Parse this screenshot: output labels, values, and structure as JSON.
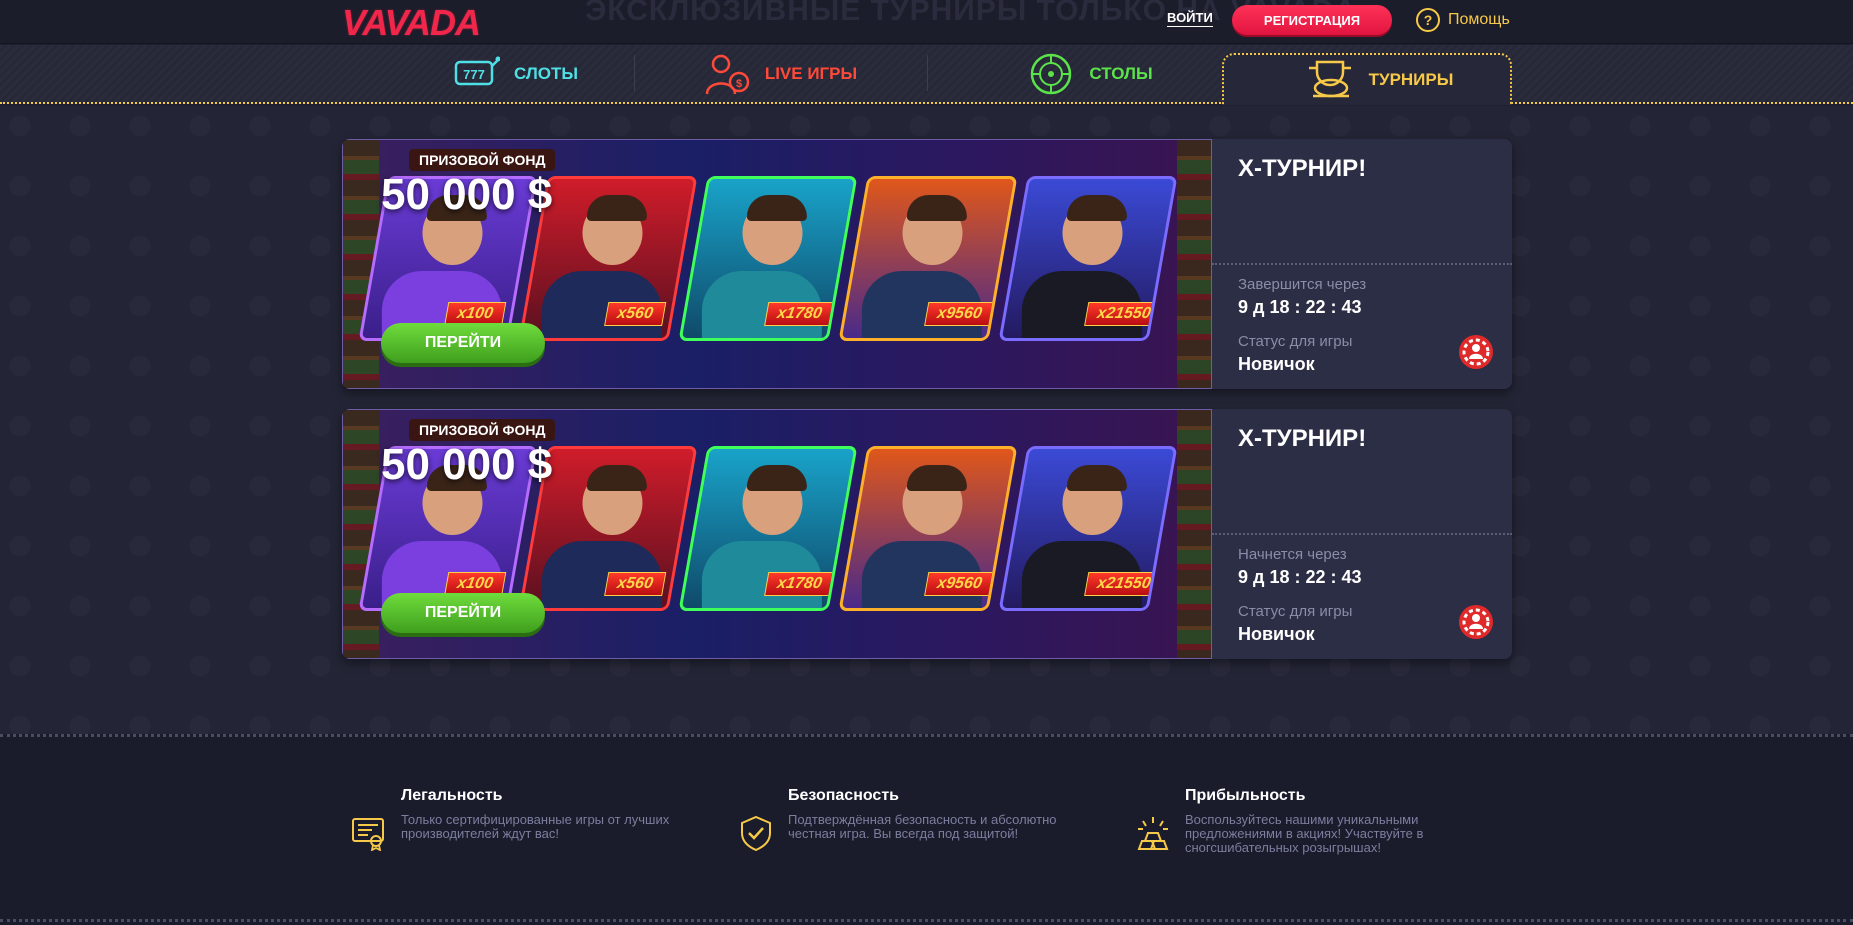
{
  "header": {
    "logo": "VAVADA",
    "ghost_title": "ЭКСКЛЮЗИВНЫЕ ТУРНИРЫ ТОЛЬКО НА VAVADA",
    "login": "ВОЙТИ",
    "register": "РЕГИСТРАЦИЯ",
    "help": "Помощь"
  },
  "nav": {
    "tabs": [
      {
        "label": "СЛОТЫ",
        "color": "#4fe0e6",
        "icon": "slots-777-icon"
      },
      {
        "label": "LIVE ИГРЫ",
        "color": "#ff4a3a",
        "icon": "live-dealer-icon"
      },
      {
        "label": "СТОЛЫ",
        "color": "#5be34a",
        "icon": "roulette-table-icon"
      },
      {
        "label": "ТУРНИРЫ",
        "color": "#f7c948",
        "icon": "piggy-trophy-icon",
        "active": true
      }
    ]
  },
  "tournaments": [
    {
      "prize_label": "ПРИЗОВОЙ ФОНД",
      "prize_amount": "50 000 $",
      "multipliers": [
        "x100",
        "x560",
        "x1780",
        "x9560",
        "x21550"
      ],
      "button": "ПЕРЕЙТИ",
      "title": "X-ТУРНИР!",
      "timer_label": "Завершится через",
      "timer_value": "9 д 18 : 22 : 43",
      "status_label": "Статус для игры",
      "status_value": "Новичок"
    },
    {
      "prize_label": "ПРИЗОВОЙ ФОНД",
      "prize_amount": "50 000 $",
      "multipliers": [
        "x100",
        "x560",
        "x1780",
        "x9560",
        "x21550"
      ],
      "button": "ПЕРЕЙТИ",
      "title": "X-ТУРНИР!",
      "timer_label": "Начнется через",
      "timer_value": "9 д 18 : 22 : 43",
      "status_label": "Статус для игры",
      "status_value": "Новичок"
    }
  ],
  "footer": {
    "features": [
      {
        "title": "Легальность",
        "text": "Только сертифицированные игры от лучших производителей ждут вас!",
        "icon": "certificate-icon"
      },
      {
        "title": "Безопасность",
        "text": "Подтверждённая безопасность и абсолютно честная игра. Вы всегда под защитой!",
        "icon": "shield-check-icon"
      },
      {
        "title": "Прибыльность",
        "text": "Воспользуйтесь нашими уникальными предложениями в акциях! Участвуйте в сногсшибательных розыгрышах!",
        "icon": "gold-bars-icon"
      }
    ]
  },
  "colors": {
    "brand_red": "#f0264a",
    "accent_yellow": "#f7c948",
    "go_green": "#4fb824"
  }
}
